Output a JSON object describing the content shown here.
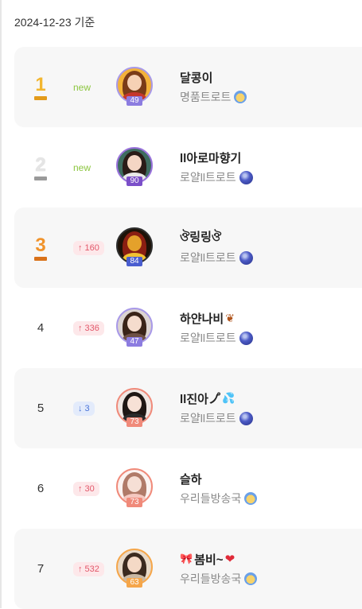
{
  "header": {
    "date": "2024-12-23 기준"
  },
  "rankings": [
    {
      "rank": "1",
      "trophy": "gold",
      "change_type": "new",
      "change_text": "new",
      "level": "49",
      "level_color": "#8c7ce0",
      "ring": "#a899e8",
      "name": "달콩이",
      "name_icon": "",
      "station": "명품트로트",
      "station_icon": "screaming-face-icon",
      "shaded": true
    },
    {
      "rank": "2",
      "trophy": "silver",
      "change_type": "new",
      "change_text": "new",
      "level": "90",
      "level_color": "#7b4fc9",
      "ring": "#9a72dc",
      "name": "ll아로마향기",
      "name_icon": "",
      "station": "로얄ll트로트",
      "station_icon": "globe-icon",
      "shaded": false
    },
    {
      "rank": "3",
      "trophy": "bronze",
      "change_type": "up",
      "change_text": "160",
      "level": "84",
      "level_color": "#4a5ed0",
      "ring": "#2e2e2e",
      "name": "ঔ링링ঔ",
      "name_icon": "",
      "station": "로얄ll트로트",
      "station_icon": "globe-icon",
      "shaded": true
    },
    {
      "rank": "4",
      "trophy": "",
      "change_type": "up",
      "change_text": "336",
      "level": "47",
      "level_color": "#8c7ce0",
      "ring": "#a899e8",
      "name": "하얀나비",
      "name_icon": "butterfly-icon",
      "station": "로얄ll트로트",
      "station_icon": "globe-icon",
      "shaded": false
    },
    {
      "rank": "5",
      "trophy": "",
      "change_type": "down",
      "change_text": "3",
      "level": "73",
      "level_color": "#f08a7a",
      "ring": "#f08a7a",
      "name": "ll진아ノ゚",
      "name_icon": "droplets-icon",
      "station": "로얄ll트로트",
      "station_icon": "globe-icon",
      "shaded": true
    },
    {
      "rank": "6",
      "trophy": "",
      "change_type": "up",
      "change_text": "30",
      "level": "73",
      "level_color": "#f08a7a",
      "ring": "#f08a7a",
      "name": "슬하",
      "name_icon": "",
      "station": "우리들방송국",
      "station_icon": "screaming-face-icon",
      "shaded": false
    },
    {
      "rank": "7",
      "trophy": "",
      "change_type": "up",
      "change_text": "532",
      "level": "63",
      "level_color": "#f5a64a",
      "ring": "#f5a64a",
      "name": "봄비~",
      "name_icon": "heart-icon",
      "station": "우리들방송국",
      "station_icon": "screaming-face-icon",
      "shaded": true
    }
  ],
  "icons": {
    "up": "arrow-up-icon",
    "down": "arrow-down-icon"
  }
}
